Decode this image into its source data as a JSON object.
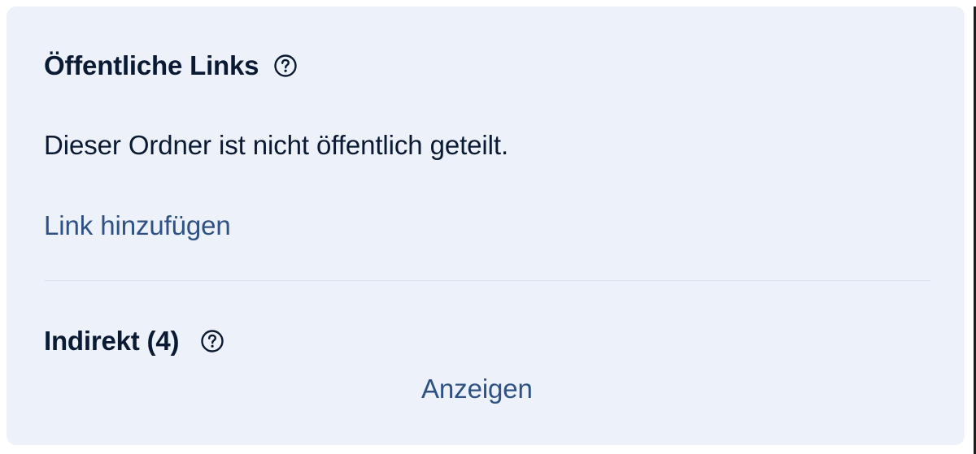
{
  "public_links": {
    "title": "Öffentliche Links",
    "help_icon": "question-circle-icon",
    "status_text": "Dieser Ordner ist nicht öffentlich geteilt.",
    "add_link_label": "Link hinzufügen"
  },
  "indirect": {
    "title": "Indirekt (4)",
    "help_icon": "question-circle-icon",
    "show_label": "Anzeigen"
  },
  "colors": {
    "panel_background": "#ecf1fa",
    "text_primary": "#0b1a33",
    "link": "#2f5184"
  }
}
